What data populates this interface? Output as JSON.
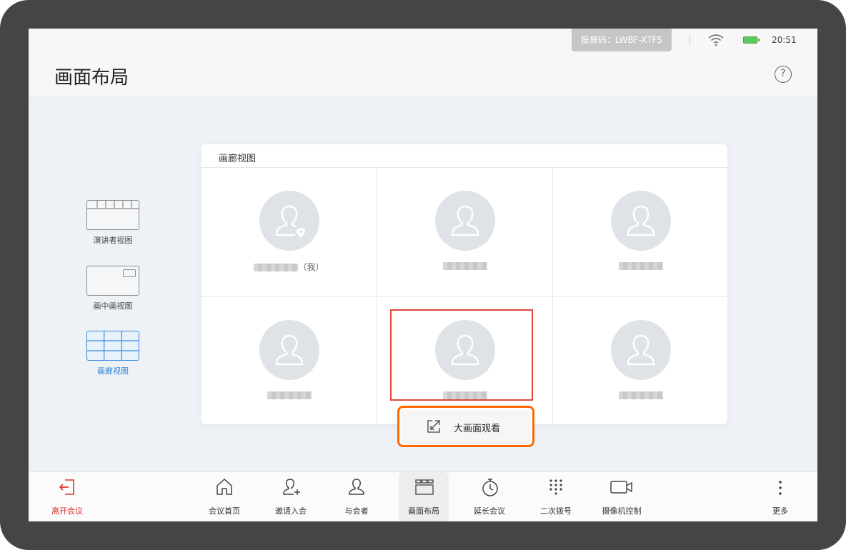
{
  "status_bar": {
    "cast_code": "投屏码：LWBF-XTFS",
    "time": "20:51",
    "wifi_icon": "wifi-icon",
    "battery_icon": "battery-icon"
  },
  "header": {
    "title": "画面布局",
    "help_icon": "question-circle-icon",
    "help_glyph": "?"
  },
  "layouts": [
    {
      "label": "演讲者视图",
      "icon": "speaker-layout-icon",
      "active": false
    },
    {
      "label": "画中画视图",
      "icon": "pip-layout-icon",
      "active": false
    },
    {
      "label": "画廊视图",
      "icon": "gallery-layout-icon",
      "active": true
    }
  ],
  "gallery": {
    "title": "画廊视图",
    "participants": [
      {
        "name_suffix": "（我）",
        "host": true
      },
      {
        "name_suffix": "",
        "host": false
      },
      {
        "name_suffix": "",
        "host": false
      },
      {
        "name_suffix": "",
        "host": false
      },
      {
        "name_suffix": "",
        "host": false
      },
      {
        "name_suffix": "",
        "host": false
      }
    ]
  },
  "big_view_button": {
    "label": "大画面观看",
    "icon": "expand-icon"
  },
  "toolbar": {
    "leave": {
      "label": "离开会议",
      "icon": "exit-icon",
      "color": "#d9302b"
    },
    "items": [
      {
        "label": "会议首页",
        "icon": "home-icon"
      },
      {
        "label": "邀请入会",
        "icon": "add-user-icon"
      },
      {
        "label": "与会者",
        "icon": "user-icon"
      },
      {
        "label": "画面布局",
        "icon": "layout-icon",
        "active": true
      },
      {
        "label": "延长会议",
        "icon": "timer-icon"
      },
      {
        "label": "二次拨号",
        "icon": "dialpad-icon"
      },
      {
        "label": "摄像机控制",
        "icon": "camera-icon"
      }
    ],
    "more": {
      "label": "更多",
      "icon": "more-vertical-icon"
    }
  },
  "colors": {
    "accent": "#2f83d6",
    "highlight_red": "#e0483d",
    "highlight_orange": "#ff6a00",
    "leave_red": "#d9302b"
  }
}
